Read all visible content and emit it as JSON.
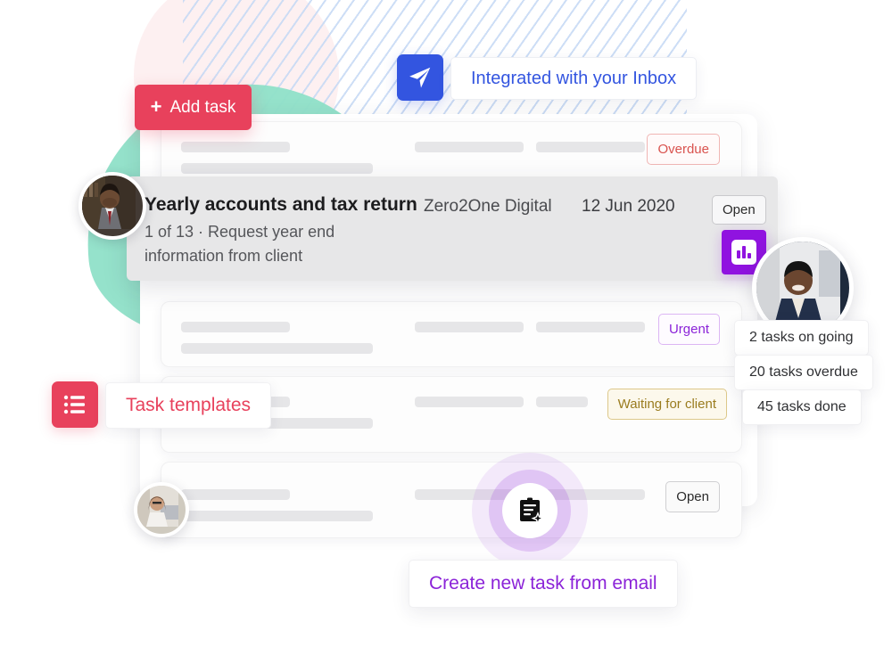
{
  "buttons": {
    "add_task": {
      "label": "Add task",
      "icon": "plus-icon",
      "color": "#e8415c"
    }
  },
  "callouts": {
    "inbox": {
      "label": "Integrated with your Inbox",
      "icon": "send-plane-icon",
      "color": "#3355e0"
    },
    "templates": {
      "label": "Task templates",
      "icon": "list-bullet-icon",
      "color": "#e8415c"
    },
    "create_from_email": {
      "label": "Create new task from email",
      "icon": "clipboard-sparkle-icon",
      "color": "#8b23d8"
    }
  },
  "highlighted_task": {
    "title": "Yearly accounts and tax return",
    "subtitle": "1 of 13 · Request year end information from client",
    "client": "Zero2One Digital",
    "due_date": "12 Jun 2020",
    "status": "Open",
    "avatar": "avatar-man-suit"
  },
  "stats": [
    {
      "label": "2 tasks on going"
    },
    {
      "label": "20 tasks overdue"
    },
    {
      "label": "45 tasks done"
    }
  ],
  "task_rows": [
    {
      "status": "Overdue"
    },
    {
      "status": "Urgent"
    },
    {
      "status": "Waiting for client"
    },
    {
      "status": "Open"
    }
  ],
  "chart_badge": {
    "icon": "bar-chart-icon",
    "color": "#9013e0"
  },
  "avatars": {
    "big": "avatar-man-cardigan",
    "small": "avatar-woman-laptop",
    "task": "avatar-man-suit"
  }
}
